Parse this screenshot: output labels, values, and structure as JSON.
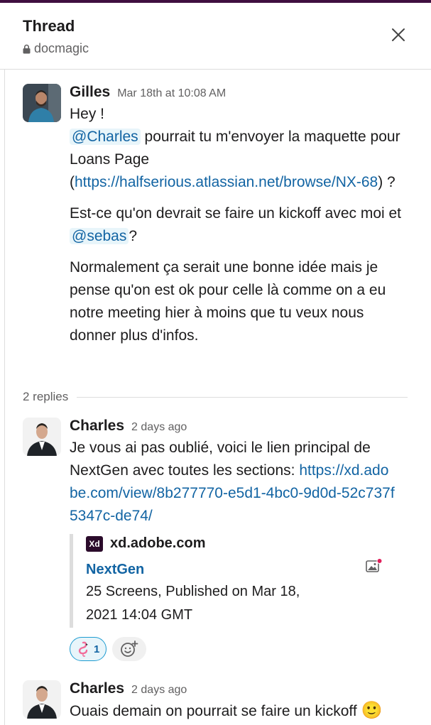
{
  "header": {
    "title": "Thread",
    "channel": "docmagic",
    "icons": {
      "lock": "lock-icon",
      "close": "close-icon"
    }
  },
  "parent": {
    "author": "Gilles",
    "timestamp": "Mar 18th at 10:08 AM",
    "line1": "Hey !",
    "mention1": "@Charles",
    "text1": " pourrait tu m'envoyer la maquette pour Loans Page (",
    "link1": "https://halfserious.atlassian.net/browse/NX-68",
    "text1_end": ") ?",
    "text2_start": "Est-ce qu'on devrait se faire un kickoff avec moi et ",
    "mention2": "@sebas",
    "text2_end": "?",
    "paragraph3": "Normalement ça serait une bonne idée mais je pense qu'on est ok pour celle là comme on a eu notre meeting hier à moins que tu veux nous donner plus d'infos."
  },
  "replies_label": "2 replies",
  "reply1": {
    "author": "Charles",
    "timestamp": "2 days ago",
    "text": "Je vous ai pas oublié, voici le lien principal de NextGen avec toutes les sections: ",
    "link": "https://xd.adobe.com/view/8b277770-e5d1-4bc0-9d0d-52c737f5347c-de74/",
    "attachment": {
      "source_logo": "Xd",
      "source": "xd.adobe.com",
      "title": "NextGen",
      "description": "25 Screens, Published on Mar 18, 2021 14:04 GMT"
    },
    "reaction": {
      "emoji": "flamingo",
      "count": "1"
    }
  },
  "reply2": {
    "author": "Charles",
    "timestamp": "2 days ago",
    "text": "Ouais demain on pourrait se faire un kickoff ",
    "emoji": "🙂"
  },
  "colors": {
    "link": "#1264a3",
    "mention_bg": "#e8f5fa",
    "reaction_border": "#1d9bd1",
    "aubergine": "#3f0e40"
  }
}
